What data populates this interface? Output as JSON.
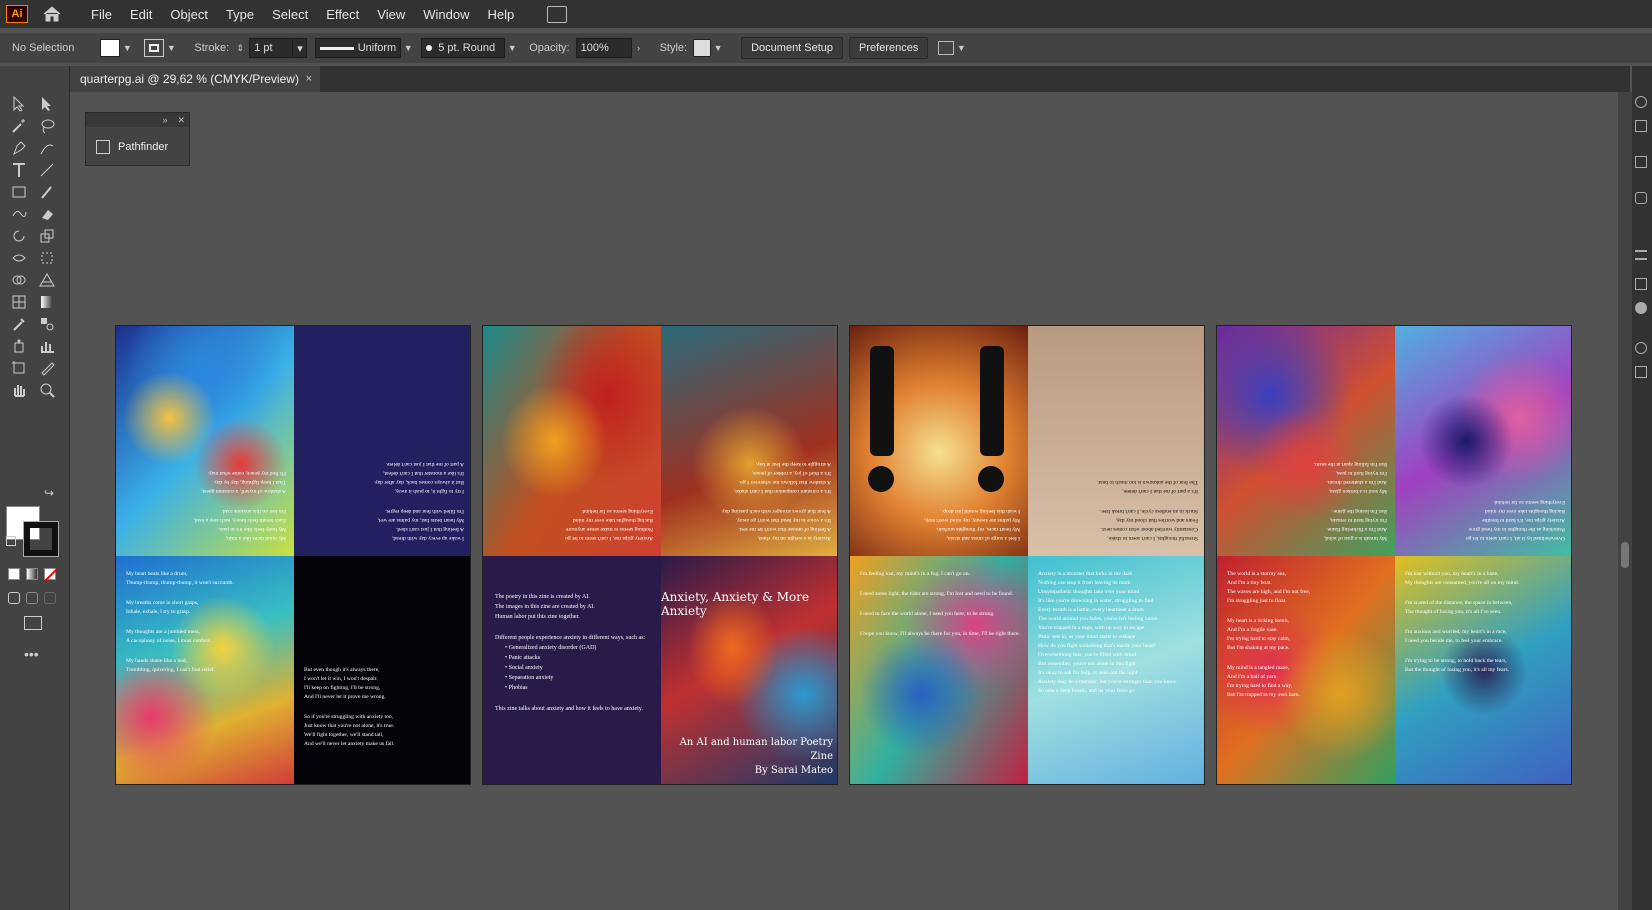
{
  "app": {
    "logo": "Ai"
  },
  "menu": [
    "File",
    "Edit",
    "Object",
    "Type",
    "Select",
    "Effect",
    "View",
    "Window",
    "Help"
  ],
  "control_bar": {
    "selection": "No Selection",
    "stroke_label": "Stroke:",
    "stroke_value": "1 pt",
    "profile": "Uniform",
    "brush": "5 pt. Round",
    "opacity_label": "Opacity:",
    "opacity_value": "100%",
    "style_label": "Style:",
    "document_setup": "Document Setup",
    "preferences": "Preferences"
  },
  "document_tab": {
    "title": "quarterpg.ai @ 29,62 % (CMYK/Preview)",
    "close": "×"
  },
  "pathfinder_panel": {
    "label": "Pathfinder"
  },
  "spreads": {
    "s1": {
      "tr_text": [
        "I wake up every day with dread,",
        "A feeling that I just can't shed.",
        "My heart beats fast, my palms are wet,",
        "I'm filled with fear and deep regret.",
        "",
        "I try to fight it, to push it away,",
        "But it always comes back, day after day.",
        "It's like a monster that I can't defeat,",
        "A part of me that I just can't delete."
      ],
      "tl_text": [
        "My mind races like a train,",
        "My body feels like it's in pain.",
        "Each breath feels heavy, each step a load,",
        "I'm lost on this anxious road.",
        "",
        "A shadow of myself, a constant guest,",
        "That I keep fighting, day by day.",
        "I'll find my peace, come what may."
      ],
      "bl_text": [
        "My heart beats like a drum,",
        "Thump-thump, thump-thump, it won't succumb.",
        "",
        "My breaths come in short gasps,",
        "Inhale, exhale, I try to grasp.",
        "",
        "My thoughts are a jumbled mess,",
        "A cacophony of noise, I must confess.",
        "",
        "My hands shake like a leaf,",
        "Trembling, quivering, I can't find relief."
      ],
      "br_text": [
        "But even though it's always there,",
        "I won't let it win, I won't despair.",
        "I'll keep on fighting, I'll be strong,",
        "And I'll never let it prove me wrong.",
        "",
        "So if you're struggling with anxiety too,",
        "Just know that you're not alone, it's true.",
        "We'll fight together, we'll stand tall,",
        "And we'll never let anxiety make us fall."
      ]
    },
    "s2": {
      "tl_text": [
        "Anxiety grips me, I can't seem to let go",
        "Nothing seems to make sense anymore",
        "Racing thoughts take over my mind",
        "Everything seems so far behind"
      ],
      "tr_text": [
        "Anxiety is a weight on my chest,",
        "A feeling of unease that won't let me rest.",
        "It's a voice in my head that won't go away,",
        "A fear that grows stronger with each passing day.",
        "",
        "It's a constant companion that I can't shake,",
        "A shadow that follows me wherever I go.",
        "It's a thief of joy, a robber of peace,",
        "A struggle to keep the fear at bay."
      ],
      "info_lines": [
        "The poetry in this zine is created by AI.",
        "The images in this zine are created by AI.",
        "Human labor put this zine together."
      ],
      "info_intro": "Different people experience anxiety in different ways, such as:",
      "info_items": [
        "Generalized anxiety disorder (GAD)",
        "Panic attacks",
        "Social anxiety",
        "Separation anxiety",
        "Phobias"
      ],
      "info_footer": "This zine talks about anxiety and how it feels to have anxiety.",
      "cover_title": "Anxiety, Anxiety & More Anxiety",
      "cover_subtitle": "An AI and human labor Poetry Zine",
      "cover_author": "By Sarai Mateo"
    },
    "s3": {
      "tl_text": [
        "I feel a surge of stress and strain,",
        "My heart races, my thoughts unchain.",
        "My palms are sweaty, my mind won't stop,",
        "I wish this feeling would just drop."
      ],
      "tr_text": [
        "Stressful thoughts, I can't seem to shake,",
        "Constantly worried about what comes next.",
        "Fears and worries that cloud my day,",
        "Stuck in an endless cycle, I can't break free.",
        "",
        "It's a part of me that I can't delete,",
        "The fear of the unknown is too much to bear."
      ],
      "bl_text": [
        "I'm feeling lost, my mind's in a fog, I can't go on.",
        "",
        "I need some light, the tides are strong, I'm lost and need to be found.",
        "",
        "I need to face the world alone, I need you here, to be strong.",
        "",
        "I hope you know, I'll always be there for you, in time, I'll be right there."
      ],
      "br_text": [
        "Anxiety is a monster that lurks in the dark",
        "Nothing can stop it from leaving its mark",
        "Unsympathetic thoughts take over your mind",
        "It's like you're drowning in water, struggling to find",
        "Every breath is a battle, every heartbeat a drum",
        "The world around you fades, you're left feeling numb",
        "You're trapped in a cage, with no way to escape",
        "Panic sets in, as your mind starts to reshape",
        "How do you fight something that's inside your head?",
        "Overwhelming fear, you're filled with dread",
        "But remember, you're not alone in this fight",
        "It's okay to ask for help, to seek out the light",
        "Anxiety may be a monster, but you're stronger than you know",
        "So take a deep breath, and let your fears go"
      ]
    },
    "s4": {
      "tl_text": [
        "My breath is a gust of wind,",
        "And I'm a flickering flame.",
        "I'm trying hard to remain,",
        "But I'm losing the game.",
        "",
        "My soul is a broken glass,",
        "And I'm a shattered dream.",
        "I'm trying hard to pass,",
        "But I'm falling apart at the seam."
      ],
      "tr_text": [
        "Overwhelmed by it all, I can't seem to let go",
        "Panicking as the thoughts in my head grow",
        "Anxiety grips me, it's hard to breathe",
        "Racing thoughts take over my mind",
        "Everything seems so far behind"
      ],
      "bl_text": [
        "The world is a stormy sea,",
        "And I'm a tiny boat.",
        "The waves are high, and I'm not free,",
        "I'm struggling just to float.",
        "",
        "My heart is a ticking bomb,",
        "And I'm a fragile vase.",
        "I'm trying hard to stay calm,",
        "But I'm shaking at my pace.",
        "",
        "My mind is a tangled maze,",
        "And I'm a ball of yarn.",
        "I'm trying hard to find a way,",
        "But I'm trapped in my own barn."
      ],
      "br_text": [
        "I'm lost without you, my heart's in a haze,",
        "My thoughts are consumed, you're all on my mind.",
        "",
        "I'm scared of the distance, the space in between,",
        "The thought of losing you, it's all I've seen.",
        "",
        "I'm anxious and worried, my heart's in a race,",
        "I need you beside me, to feel your embrace.",
        "",
        "I'm trying to be strong, to hold back the tears,",
        "But the thought of losing you, it's all my fears."
      ]
    }
  }
}
